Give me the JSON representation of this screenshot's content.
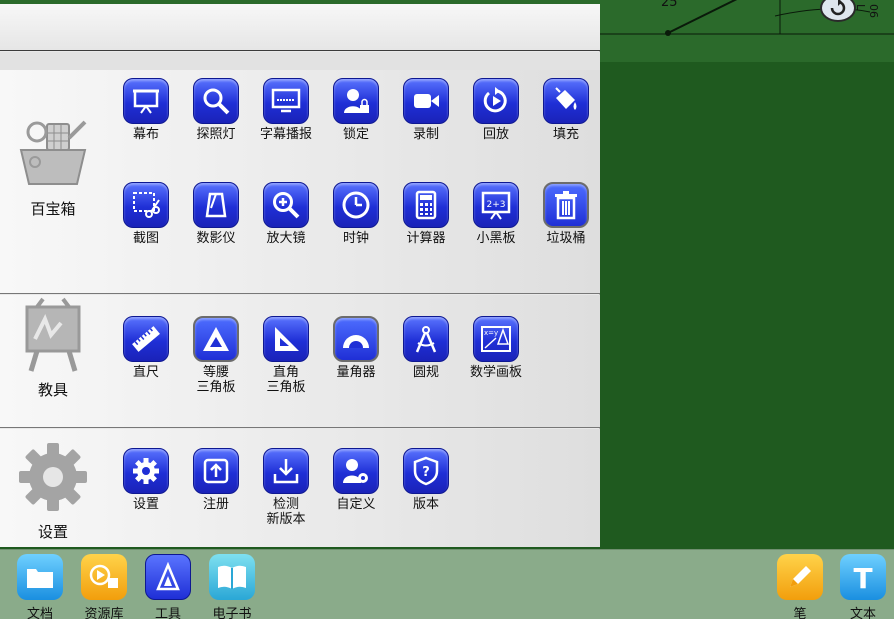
{
  "board": {
    "angle_label": "25°",
    "ruler_label": "06 L"
  },
  "categories": [
    {
      "label": "百宝箱",
      "icon": "treasure-box-icon"
    },
    {
      "label": "教具",
      "icon": "easel-icon"
    },
    {
      "label": "设置",
      "icon": "gear-icon"
    }
  ],
  "treasure_tools": [
    {
      "label": "幕布",
      "icon": "curtain-icon"
    },
    {
      "label": "探照灯",
      "icon": "spotlight-icon"
    },
    {
      "label": "字幕播报",
      "icon": "subtitle-icon"
    },
    {
      "label": "锁定",
      "icon": "lock-user-icon"
    },
    {
      "label": "录制",
      "icon": "video-camera-icon"
    },
    {
      "label": "回放",
      "icon": "replay-icon"
    },
    {
      "label": "填充",
      "icon": "paint-bucket-icon"
    },
    {
      "label": "截图",
      "icon": "screenshot-scissors-icon"
    },
    {
      "label": "数影仪",
      "icon": "document-camera-icon"
    },
    {
      "label": "放大镜",
      "icon": "magnifier-icon"
    },
    {
      "label": "时钟",
      "icon": "clock-icon"
    },
    {
      "label": "计算器",
      "icon": "calculator-icon"
    },
    {
      "label": "小黑板",
      "icon": "blackboard-icon"
    },
    {
      "label": "垃圾桶",
      "icon": "trash-icon"
    }
  ],
  "teaching_tools": [
    {
      "label": "直尺",
      "icon": "ruler-icon"
    },
    {
      "label": "等腰\n三角板",
      "icon": "isosceles-triangle-icon"
    },
    {
      "label": "直角\n三角板",
      "icon": "right-triangle-icon"
    },
    {
      "label": "量角器",
      "icon": "protractor-icon"
    },
    {
      "label": "圆规",
      "icon": "compass-icon"
    },
    {
      "label": "数学画板",
      "icon": "math-board-icon"
    }
  ],
  "settings_tools": [
    {
      "label": "设置",
      "icon": "gear-icon"
    },
    {
      "label": "注册",
      "icon": "register-icon"
    },
    {
      "label": "检测\n新版本",
      "icon": "download-icon"
    },
    {
      "label": "自定义",
      "icon": "user-gear-icon"
    },
    {
      "label": "版本",
      "icon": "shield-question-icon"
    }
  ],
  "taskbar": {
    "left": [
      {
        "label": "文档",
        "icon": "folder-icon"
      },
      {
        "label": "资源库",
        "icon": "media-library-icon"
      },
      {
        "label": "工具",
        "icon": "triangle-tools-icon"
      },
      {
        "label": "电子书",
        "icon": "book-icon"
      }
    ],
    "right": [
      {
        "label": "笔",
        "icon": "pen-icon"
      },
      {
        "label": "文本",
        "icon": "text-icon"
      }
    ]
  },
  "colors": {
    "board": "#1f5a1f",
    "tool_blue": "#1f2fd6",
    "taskbar": "#8aab8a"
  }
}
